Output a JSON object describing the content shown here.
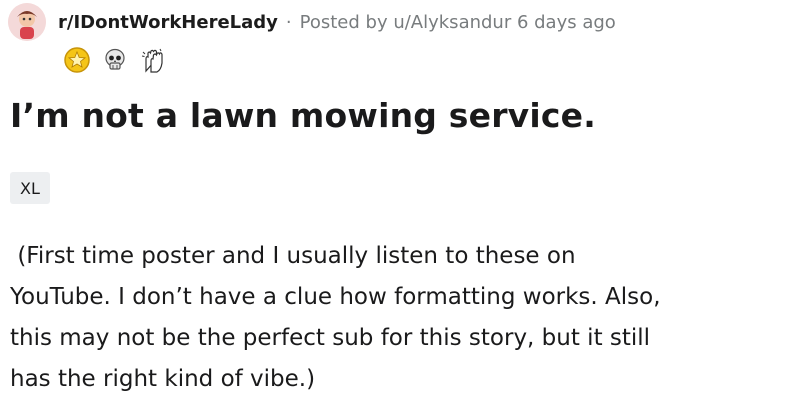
{
  "post": {
    "subreddit": "r/IDontWorkHereLady",
    "separator": "·",
    "posted_by": "Posted by u/Alyksandur 6 days ago",
    "awards": [
      {
        "icon": "gold-star-award-icon"
      },
      {
        "icon": "skull-award-icon"
      },
      {
        "icon": "clapping-hands-award-icon"
      }
    ],
    "title": "I’m not a lawn mowing service.",
    "flair": "XL",
    "body": " (First time poster and I usually listen to these on\nYouTube. I don’t have a clue how formatting works. Also,\nthis may not be the perfect sub for this story, but it still\nhas the right kind of vibe.)"
  },
  "colors": {
    "text": "#1a1a1b",
    "meta": "#787c7e",
    "flair_bg": "#edeff1",
    "gold": "#f5c518"
  }
}
